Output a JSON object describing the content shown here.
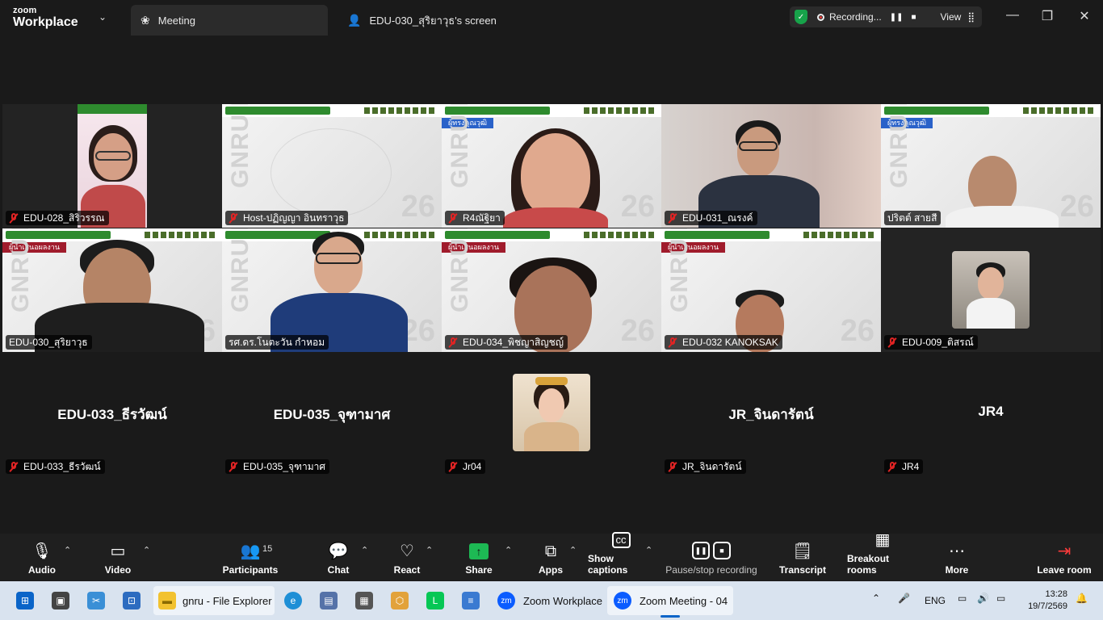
{
  "titlebar": {
    "brand_top": "zoom",
    "brand_bottom": "Workplace",
    "active_tab": "Meeting",
    "share_tab": "EDU-030_สุริยาวุธ's screen",
    "recording_label": "Recording...",
    "view_label": "View"
  },
  "tiles": {
    "t1": "EDU-028_สิริวรรณ",
    "t2": "Host-ปฏิญญา อินทราวุธ",
    "t3": "R4ณัฐิยา",
    "t4": "EDU-031_ณรงค์",
    "t5": "ปริตต์ สายสี",
    "t6": "EDU-030_สุริยาวุธ",
    "t7": "รศ.ดร.โนตะวัน  กำหอม",
    "t8": "EDU-034_พิชญาสิญชญ์",
    "t9": "EDU-032 KANOKSAK",
    "t10": "EDU-009_ติสรณ์",
    "t11_center": "EDU-033_ธีรวัฒน์",
    "t11": "EDU-033_ธีรวัฒน์",
    "t12_center": "EDU-035_จุฑามาศ",
    "t12": "EDU-035_จุฑามาศ",
    "t13": "Jr04",
    "t14_center": "JR_จินดารัตน์",
    "t14": "JR_จินดารัตน์",
    "t15_center": "JR4",
    "t15": "JR4"
  },
  "slide": {
    "label_blue": "ผู้ทรงคุณวุฒิ",
    "label_red": "ผู้นำเสนอผลงาน",
    "watermark": "GNRU LPRU",
    "number": "26"
  },
  "controls": {
    "audio": "Audio",
    "video": "Video",
    "participants": "Participants",
    "participants_count": "15",
    "chat": "Chat",
    "react": "React",
    "share": "Share",
    "apps": "Apps",
    "captions": "Show captions",
    "pause_rec": "Pause/stop recording",
    "transcript": "Transcript",
    "breakout": "Breakout rooms",
    "more": "More",
    "leave": "Leave room"
  },
  "taskbar": {
    "file_explorer": "gnru - File Explorer",
    "zoom_workplace": "Zoom Workplace",
    "zoom_meeting": "Zoom Meeting - 04",
    "lang": "ENG",
    "time": "13:28",
    "date": "19/7/2569"
  },
  "colors": {
    "active_speaker": "#2ed36b",
    "mute_red": "#e02424",
    "share_green": "#1db954",
    "slide_green": "#2e8b2e"
  }
}
